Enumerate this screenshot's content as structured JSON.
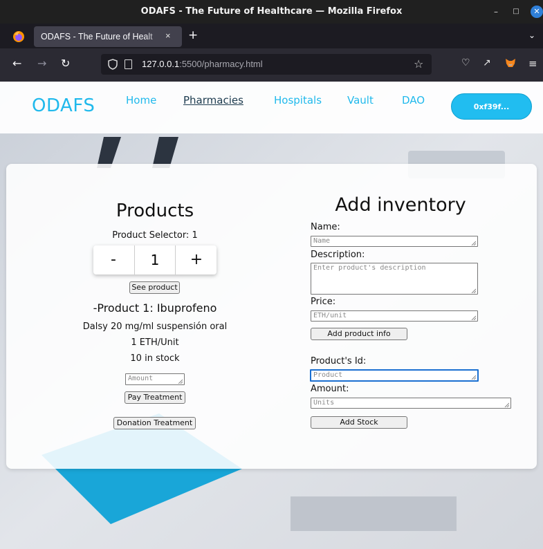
{
  "window": {
    "title": "ODAFS - The Future of Healthcare — Mozilla Firefox"
  },
  "tab": {
    "label": "ODAFS - The Future of Healt",
    "close": "×"
  },
  "browser": {
    "new_tab": "+",
    "url_host": "127.0.0.1",
    "url_path": ":5500/pharmacy.html"
  },
  "site": {
    "logo": "ODAFS",
    "nav": [
      "Home",
      "Pharmacies",
      "Hospitals",
      "Vault",
      "DAO"
    ],
    "active_nav": "Pharmacies",
    "wallet": "0xf39f..."
  },
  "products": {
    "heading": "Products",
    "selector_label": "Product Selector: 1",
    "stepper": {
      "minus": "-",
      "value": "1",
      "plus": "+"
    },
    "see_product": "See product",
    "title": "-Product 1: Ibuprofeno",
    "description": "Dalsy 20 mg/ml suspensión oral",
    "price": "1 ETH/Unit",
    "stock": "10 in stock",
    "amount_placeholder": "Amount",
    "pay_button": "Pay Treatment",
    "donate_button": "Donation Treatment"
  },
  "inventory": {
    "heading": "Add inventory",
    "name_label": "Name:",
    "name_placeholder": "Name",
    "description_label": "Description:",
    "description_placeholder": "Enter product's description",
    "price_label": "Price:",
    "price_placeholder": "ETH/unit",
    "add_info_button": "Add product info",
    "product_id_label": "Product's Id:",
    "product_id_placeholder": "Product",
    "amount_label": "Amount:",
    "amount_placeholder": "Units",
    "add_stock_button": "Add Stock"
  },
  "colors": {
    "accent": "#20b9ec",
    "active_nav": "#1c3a4e",
    "chrome_dark": "#2b2a33"
  }
}
